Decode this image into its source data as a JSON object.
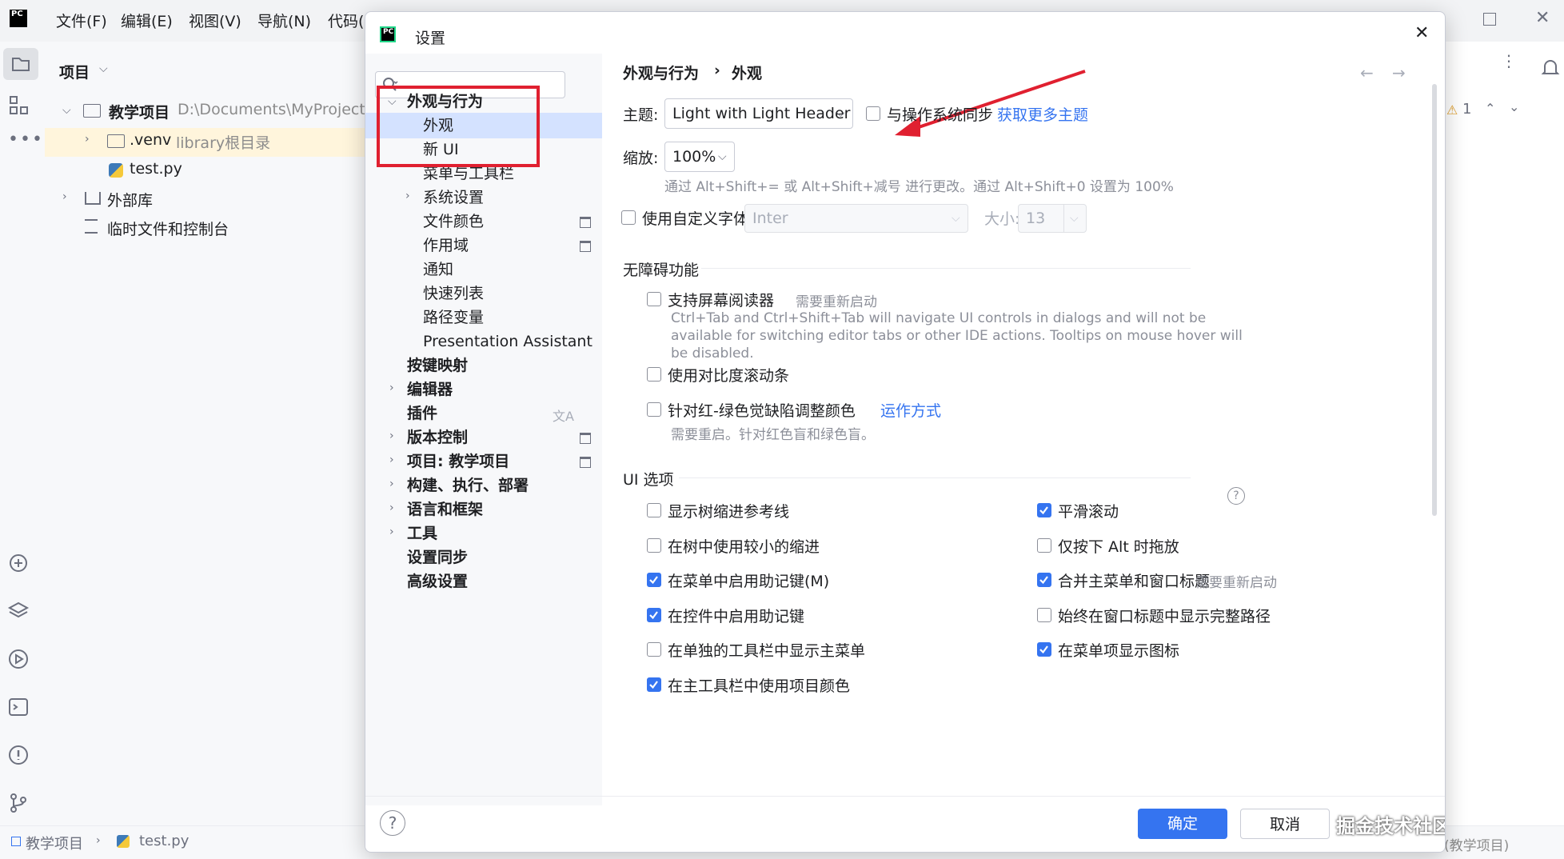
{
  "ide": {
    "menus": [
      "文件(F)",
      "编辑(E)",
      "视图(V)",
      "导航(N)",
      "代码("
    ],
    "project_panel_title": "项目",
    "tree": {
      "root_label": "教学项目",
      "root_path": "D:\\Documents\\MyProjects",
      "venv_label": ".venv",
      "venv_hint": "library根目录",
      "file_label": "test.py",
      "external_libs": "外部库",
      "scratches": "临时文件和控制台"
    },
    "status": {
      "project": "教学项目",
      "file": "test.py",
      "right": "(教学项目)"
    },
    "warning_count": "1"
  },
  "dialog": {
    "title": "设置",
    "search": {
      "value": "",
      "placeholder": ""
    },
    "nav": {
      "appearance_behavior": "外观与行为",
      "appearance": "外观",
      "new_ui": "新 UI",
      "menus_toolbars": "菜单与工具栏",
      "system_settings": "系统设置",
      "file_colors": "文件颜色",
      "scopes": "作用域",
      "notifications": "通知",
      "quick_lists": "快速列表",
      "path_variables": "路径变量",
      "presentation_assistant": "Presentation Assistant",
      "keymap": "按键映射",
      "editor": "编辑器",
      "plugins": "插件",
      "version_control": "版本控制",
      "project": "项目: 教学项目",
      "build": "构建、执行、部署",
      "languages": "语言和框架",
      "tools": "工具",
      "settings_sync": "设置同步",
      "advanced": "高级设置"
    },
    "breadcrumb": {
      "parent": "外观与行为",
      "sep": "›",
      "current": "外观"
    },
    "theme": {
      "label": "主题:",
      "value": "Light with Light Header",
      "sync_label": "与操作系统同步",
      "sync_checked": false,
      "more_themes_link": "获取更多主题"
    },
    "zoom": {
      "label": "缩放:",
      "value": "100%",
      "hint": "通过 Alt+Shift+= 或 Alt+Shift+减号 进行更改。通过 Alt+Shift+0 设置为 100%"
    },
    "custom_font": {
      "label": "使用自定义字体:",
      "checked": false,
      "font_value": "Inter",
      "size_label": "大小:",
      "size_value": "13"
    },
    "accessibility": {
      "title": "无障碍功能",
      "screen_reader": "支持屏幕阅读器",
      "screen_reader_hint": "需要重新启动",
      "screen_reader_desc": "Ctrl+Tab and Ctrl+Shift+Tab will navigate UI controls in dialogs and will not be available for switching editor tabs or other IDE actions. Tooltips on mouse hover will be disabled.",
      "contrast_scrollbars": "使用对比度滚动条",
      "color_deficiency": "针对红-绿色觉缺陷调整颜色",
      "how_it_works_link": "运作方式",
      "color_hint": "需要重启。针对红色盲和绿色盲。"
    },
    "ui_options": {
      "title": "UI 选项",
      "left": [
        {
          "label": "显示树缩进参考线",
          "checked": false
        },
        {
          "label": "在树中使用较小的缩进",
          "checked": false
        },
        {
          "label": "在菜单中启用助记键(M)",
          "checked": true
        },
        {
          "label": "在控件中启用助记键",
          "checked": true
        },
        {
          "label": "在单独的工具栏中显示主菜单",
          "checked": false
        },
        {
          "label": "在主工具栏中使用项目颜色",
          "checked": true
        }
      ],
      "right": [
        {
          "label": "平滑滚动",
          "checked": true,
          "hint": ""
        },
        {
          "label": "仅按下 Alt 时拖放",
          "checked": false,
          "hint": ""
        },
        {
          "label": "合并主菜单和窗口标题",
          "checked": true,
          "hint": "需要重新启动"
        },
        {
          "label": "始终在窗口标题中显示完整路径",
          "checked": false,
          "hint": ""
        },
        {
          "label": "在菜单项显示图标",
          "checked": true,
          "hint": ""
        }
      ]
    },
    "buttons": {
      "ok": "确定",
      "cancel": "取消",
      "help": "?"
    },
    "watermark": "掘金技术社区 @ 凌小添"
  },
  "colors": {
    "accent": "#3574f0",
    "annotation_red": "#e02030",
    "selection": "#d4e2ff"
  }
}
